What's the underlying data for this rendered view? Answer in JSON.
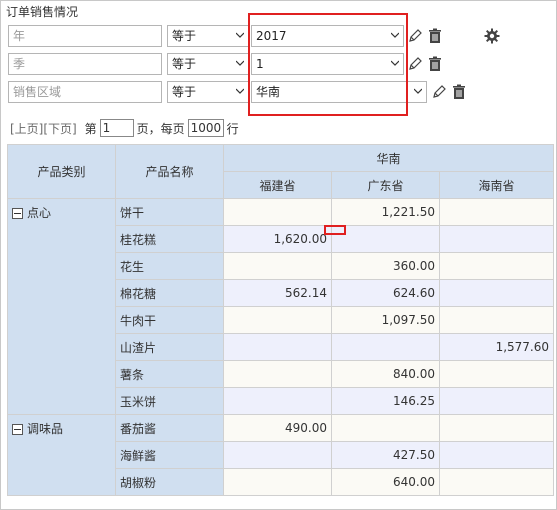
{
  "title": "订单销售情况",
  "filters": [
    {
      "field_placeholder": "年",
      "operator": "等于",
      "value": "2017"
    },
    {
      "field_placeholder": "季",
      "operator": "等于",
      "value": "1"
    },
    {
      "field_placeholder": "销售区域",
      "operator": "等于",
      "value": "华南"
    }
  ],
  "pager": {
    "prev": "[上页]",
    "next": "[下页]",
    "page_prefix": "第",
    "page": "1",
    "page_suffix": "页，每页",
    "per_page": "1000",
    "rows_unit": "行"
  },
  "table": {
    "col_category": "产品类别",
    "col_product": "产品名称",
    "region": "华南",
    "provinces": [
      "福建省",
      "广东省",
      "海南省"
    ],
    "groups": [
      {
        "category": "点心",
        "rows": [
          {
            "name": "饼干",
            "v": [
              "",
              "1,221.50",
              ""
            ]
          },
          {
            "name": "桂花糕",
            "v": [
              "1,620.00",
              "",
              ""
            ]
          },
          {
            "name": "花生",
            "v": [
              "",
              "360.00",
              ""
            ]
          },
          {
            "name": "棉花糖",
            "v": [
              "562.14",
              "624.60",
              ""
            ]
          },
          {
            "name": "牛肉干",
            "v": [
              "",
              "1,097.50",
              ""
            ]
          },
          {
            "name": "山渣片",
            "v": [
              "",
              "",
              "1,577.60"
            ]
          },
          {
            "name": "薯条",
            "v": [
              "",
              "840.00",
              ""
            ]
          },
          {
            "name": "玉米饼",
            "v": [
              "",
              "146.25",
              ""
            ]
          }
        ]
      },
      {
        "category": "调味品",
        "rows": [
          {
            "name": "番茄酱",
            "v": [
              "490.00",
              "",
              ""
            ]
          },
          {
            "name": "海鲜酱",
            "v": [
              "",
              "427.50",
              ""
            ]
          },
          {
            "name": "胡椒粉",
            "v": [
              "",
              "640.00",
              ""
            ]
          }
        ]
      }
    ]
  },
  "colors": {
    "highlight_border": "#e02020",
    "header_bg": "#d0dff0"
  }
}
